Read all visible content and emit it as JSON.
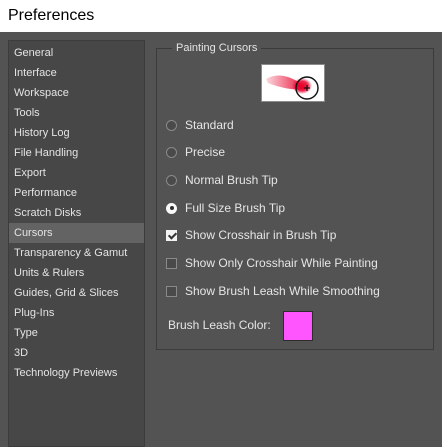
{
  "window": {
    "title": "Preferences"
  },
  "sidebar": {
    "items": [
      {
        "label": "General"
      },
      {
        "label": "Interface"
      },
      {
        "label": "Workspace"
      },
      {
        "label": "Tools"
      },
      {
        "label": "History Log"
      },
      {
        "label": "File Handling"
      },
      {
        "label": "Export"
      },
      {
        "label": "Performance"
      },
      {
        "label": "Scratch Disks"
      },
      {
        "label": "Cursors",
        "selected": true
      },
      {
        "label": "Transparency & Gamut"
      },
      {
        "label": "Units & Rulers"
      },
      {
        "label": "Guides, Grid & Slices"
      },
      {
        "label": "Plug-Ins"
      },
      {
        "label": "Type"
      },
      {
        "label": "3D"
      },
      {
        "label": "Technology Previews"
      }
    ]
  },
  "painting_cursors": {
    "title": "Painting Cursors",
    "preview_icon": "brush-stroke-crosshair-icon",
    "options": {
      "standard": "Standard",
      "precise": "Precise",
      "normal_brush_tip": "Normal Brush Tip",
      "full_size_brush_tip": "Full Size Brush Tip"
    },
    "selected_option": "Full Size Brush Tip",
    "checkboxes": {
      "show_crosshair": {
        "label": "Show Crosshair in Brush Tip",
        "checked": true
      },
      "show_only_crosshair": {
        "label": "Show Only Crosshair While Painting",
        "checked": false
      },
      "show_brush_leash": {
        "label": "Show Brush Leash While Smoothing",
        "checked": false
      }
    },
    "brush_leash_color_label": "Brush Leash Color:",
    "brush_leash_color": "#ff55ff"
  },
  "colors": {
    "background": "#535353",
    "sidebar_bg": "#474747",
    "selected_bg": "#636363",
    "stroke_red": "#e8002a"
  }
}
